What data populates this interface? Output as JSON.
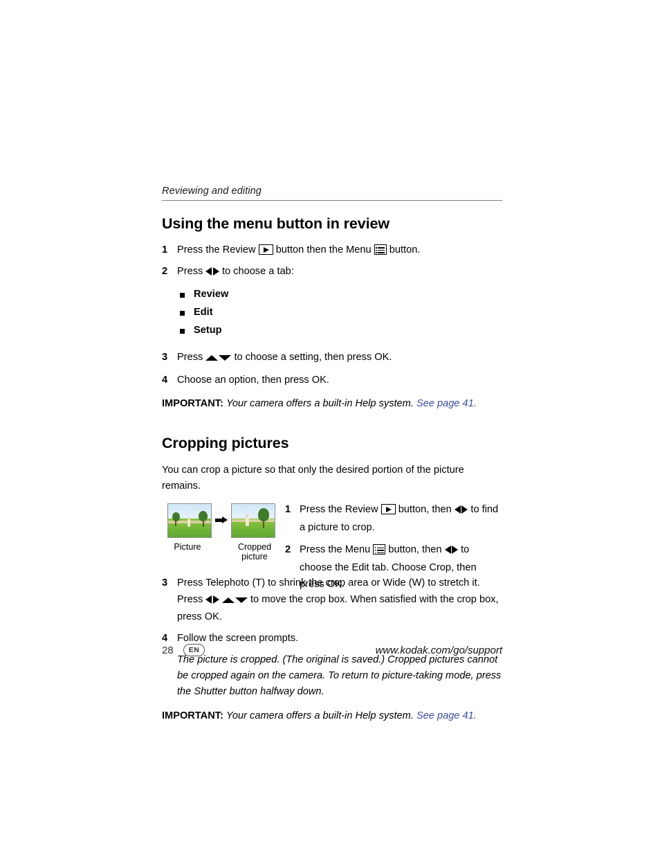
{
  "header": {
    "running_head": "Reviewing and editing"
  },
  "section1": {
    "title": "Using the menu button in review",
    "steps": [
      {
        "num": "1",
        "parts": [
          "Press the Review ",
          "review-icon",
          " button then the Menu ",
          "menu-icon",
          " button."
        ],
        "text_before": "Press the Review",
        "text_mid": "button then the Menu",
        "text_after": "button."
      },
      {
        "num": "2",
        "text_before": "Press",
        "text_after": "to choose a tab:"
      },
      {
        "num": "3",
        "text_before": "Press",
        "text_after": "to choose a setting, then press OK."
      },
      {
        "num": "4",
        "text": "Choose an option, then press OK."
      }
    ],
    "tabs": [
      "Review",
      "Edit",
      "Setup"
    ],
    "important_label": "IMPORTANT:",
    "important_text": "Your camera offers a built-in Help system.",
    "important_link": "See page 41."
  },
  "section2": {
    "title": "Cropping pictures",
    "intro": "You can crop a picture so that only the desired portion of the picture remains.",
    "figure_captions": {
      "left": "Picture",
      "right": "Cropped picture"
    },
    "steps": [
      {
        "num": "1",
        "text_before": "Press the Review",
        "text_mid": "button, then",
        "text_after": "to find a picture to crop."
      },
      {
        "num": "2",
        "text_before": "Press the Menu",
        "text_mid": "button, then",
        "text_after": "to choose the Edit tab. Choose Crop, then press OK."
      },
      {
        "num": "3",
        "text_before": "Press Telephoto (T) to shrink the crop area or Wide (W) to stretch it. Press",
        "text_after": "to move the crop box. When satisfied with the crop box, press OK."
      },
      {
        "num": "4",
        "text": "Follow the screen prompts."
      }
    ],
    "note": "The picture is cropped. (The original is saved.) Cropped pictures cannot be cropped again on the camera. To return to picture-taking mode, press the Shutter button halfway down.",
    "important_label": "IMPORTANT:",
    "important_text": "Your camera offers a built-in Help system.",
    "important_link": "See page 41."
  },
  "footer": {
    "page_number": "28",
    "language_badge": "EN",
    "url": "www.kodak.com/go/support"
  }
}
